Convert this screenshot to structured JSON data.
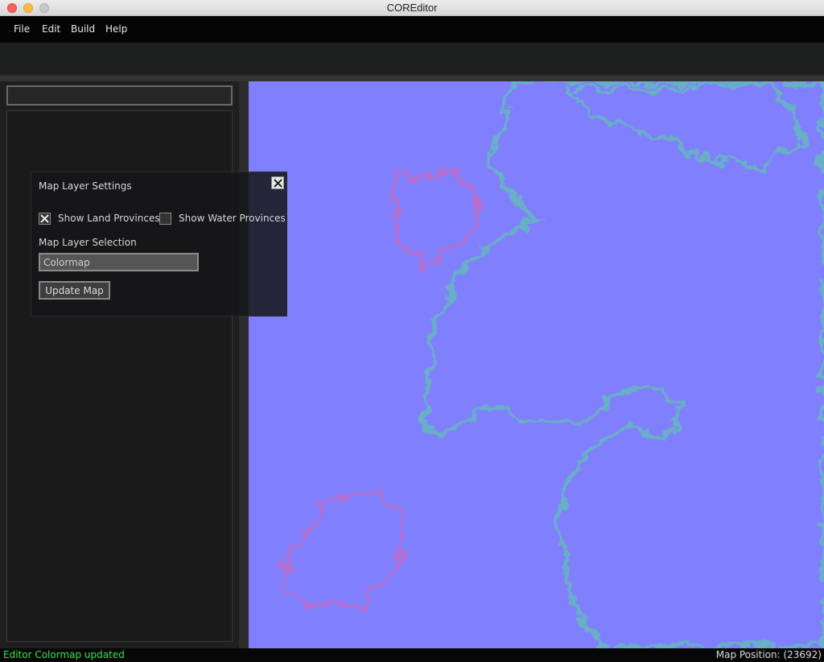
{
  "window": {
    "title": "COREditor"
  },
  "menu": {
    "items": [
      {
        "label": "File"
      },
      {
        "label": "Edit"
      },
      {
        "label": "Build"
      },
      {
        "label": "Help"
      }
    ]
  },
  "left_panel": {
    "search_value": ""
  },
  "dialog": {
    "title": "Map Layer Settings",
    "show_land_label": "Show Land Provinces",
    "show_land_checked": true,
    "show_water_label": "Show Water Provinces",
    "show_water_checked": false,
    "section_label": "Map Layer Selection",
    "layer_value": "Colormap",
    "update_button": "Update Map"
  },
  "map": {
    "water_color": "#8080ff"
  },
  "status": {
    "message": "Editor Colormap updated",
    "message_color": "#39e44c",
    "map_position": "Map Position: (23692)"
  },
  "icons": {
    "close": "close-icon",
    "checkbox_checked": "checkbox-checked-icon"
  }
}
